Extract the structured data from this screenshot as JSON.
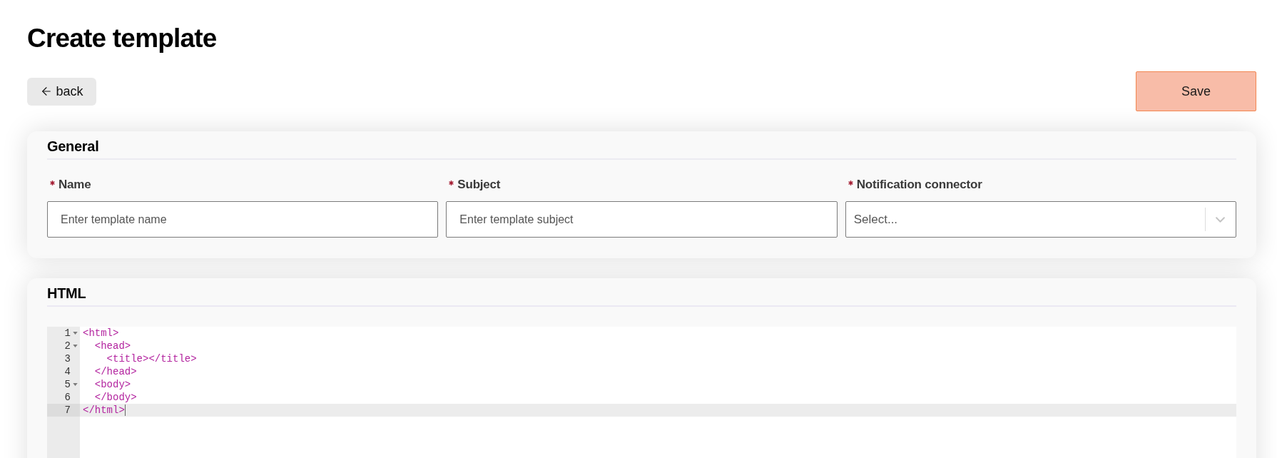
{
  "page": {
    "title": "Create template"
  },
  "actions": {
    "back": {
      "label": "back"
    },
    "save": {
      "label": "Save"
    }
  },
  "general": {
    "title": "General",
    "fields": [
      {
        "kind": "text",
        "label": "Name",
        "required": true,
        "placeholder": "Enter template name"
      },
      {
        "kind": "text",
        "label": "Subject",
        "required": true,
        "placeholder": "Enter template subject"
      },
      {
        "kind": "select",
        "label": "Notification connector",
        "required": true,
        "placeholder": "Select..."
      }
    ]
  },
  "html": {
    "title": "HTML",
    "editor": {
      "lines": [
        {
          "number": "1",
          "code": "<html>",
          "foldable": true,
          "active": false
        },
        {
          "number": "2",
          "code": "  <head>",
          "foldable": true,
          "active": false
        },
        {
          "number": "3",
          "code": "    <title></title>",
          "foldable": false,
          "active": false
        },
        {
          "number": "4",
          "code": "  </head>",
          "foldable": false,
          "active": false
        },
        {
          "number": "5",
          "code": "  <body>",
          "foldable": true,
          "active": false
        },
        {
          "number": "6",
          "code": "  </body>",
          "foldable": false,
          "active": false
        },
        {
          "number": "7",
          "code": "</html>",
          "foldable": false,
          "active": true
        }
      ]
    }
  }
}
